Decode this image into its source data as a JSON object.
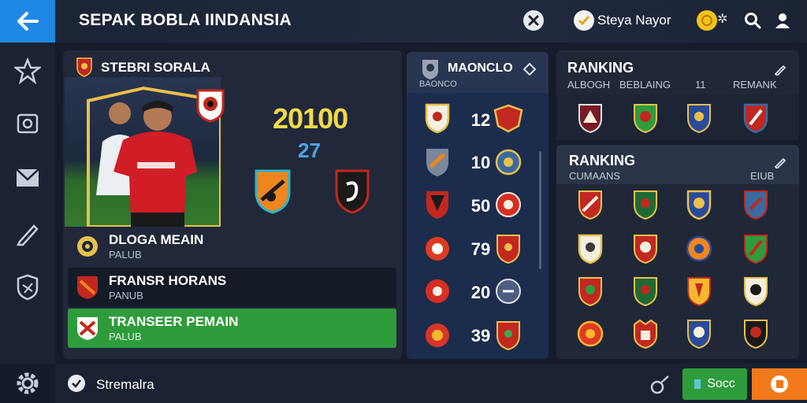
{
  "header": {
    "title": "SEPAK BOBLA IINDANSIA",
    "user_name": "Steya Nayor"
  },
  "player_card": {
    "club_name": "STEBRI SORALA",
    "stat_main": "20100",
    "stat_secondary": "27"
  },
  "menu_rows": [
    {
      "title": "DLOGA MEAIN",
      "subtitle": "PALUB"
    },
    {
      "title": "FRANSR HORANS",
      "subtitle": "PANUB"
    },
    {
      "title": "TRANSEER PEMAIN",
      "subtitle": "PALUB"
    }
  ],
  "middle_panel": {
    "title": "MAONCLO",
    "subtitle": "BAONCO",
    "numbers": [
      "12",
      "10",
      "50",
      "79",
      "20",
      "39"
    ]
  },
  "ranking_top": {
    "title": "RANKING",
    "columns": [
      "ALBOGH",
      "BEBLAING",
      "11",
      "REMANK"
    ]
  },
  "ranking_bottom": {
    "title": "RANKING",
    "sub_left": "CUMAANS",
    "sub_right": "EIUB"
  },
  "footer": {
    "status": "Stremalra",
    "save_label": "Socc"
  },
  "colors": {
    "accent_blue": "#1f88e6",
    "active_green": "#2f9c3c",
    "orange": "#f27a1a",
    "gold": "#f3d94a"
  }
}
